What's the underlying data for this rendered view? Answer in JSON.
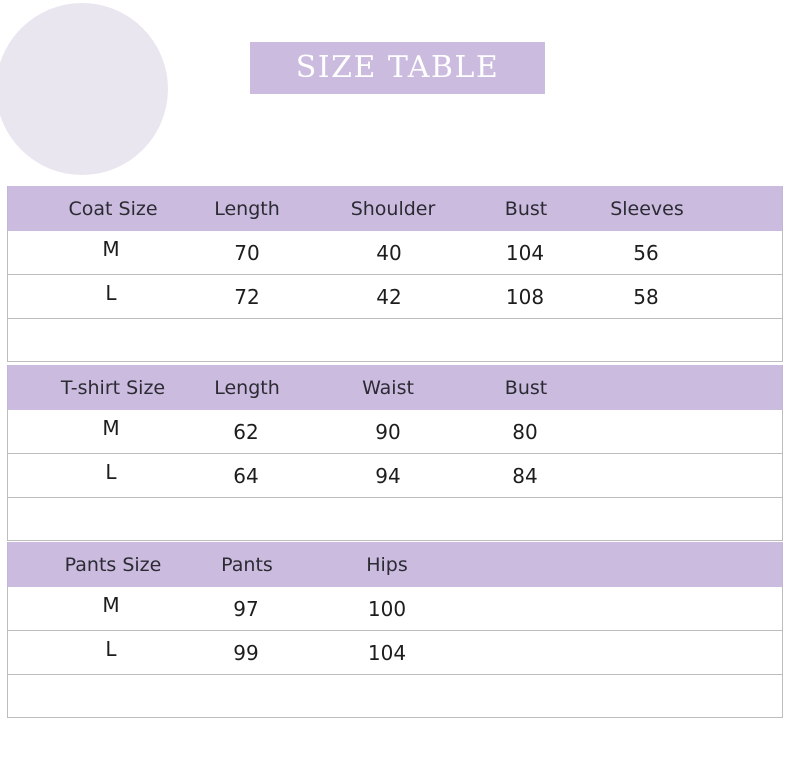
{
  "title": {
    "text": "SIZE TABLE",
    "banner_color": "#cbbbdf",
    "text_color": "#ffffff"
  },
  "decor": {
    "circle_color": "#eae6f0"
  },
  "theme": {
    "header_purple": "#cbbbdf",
    "row_white": "#ffffff",
    "border_gray": "#bdbdbd",
    "text_dark": "#1d1d1d"
  },
  "tables": [
    {
      "id": "coat",
      "headers": [
        "Coat Size",
        "Length",
        "Shoulder",
        "Bust",
        "Sleeves"
      ],
      "rows": [
        [
          "M",
          "70",
          "40",
          "104",
          "56"
        ],
        [
          "L",
          "72",
          "42",
          "108",
          "58"
        ]
      ]
    },
    {
      "id": "tshirt",
      "headers": [
        "T-shirt Size",
        "Length",
        "Waist",
        "Bust"
      ],
      "rows": [
        [
          "M",
          "62",
          "90",
          "80"
        ],
        [
          "L",
          "64",
          "94",
          "84"
        ]
      ]
    },
    {
      "id": "pants",
      "headers": [
        "Pants Size",
        "Pants",
        "Hips"
      ],
      "rows": [
        [
          "M",
          "97",
          "100"
        ],
        [
          "L",
          "99",
          "104"
        ]
      ]
    }
  ]
}
